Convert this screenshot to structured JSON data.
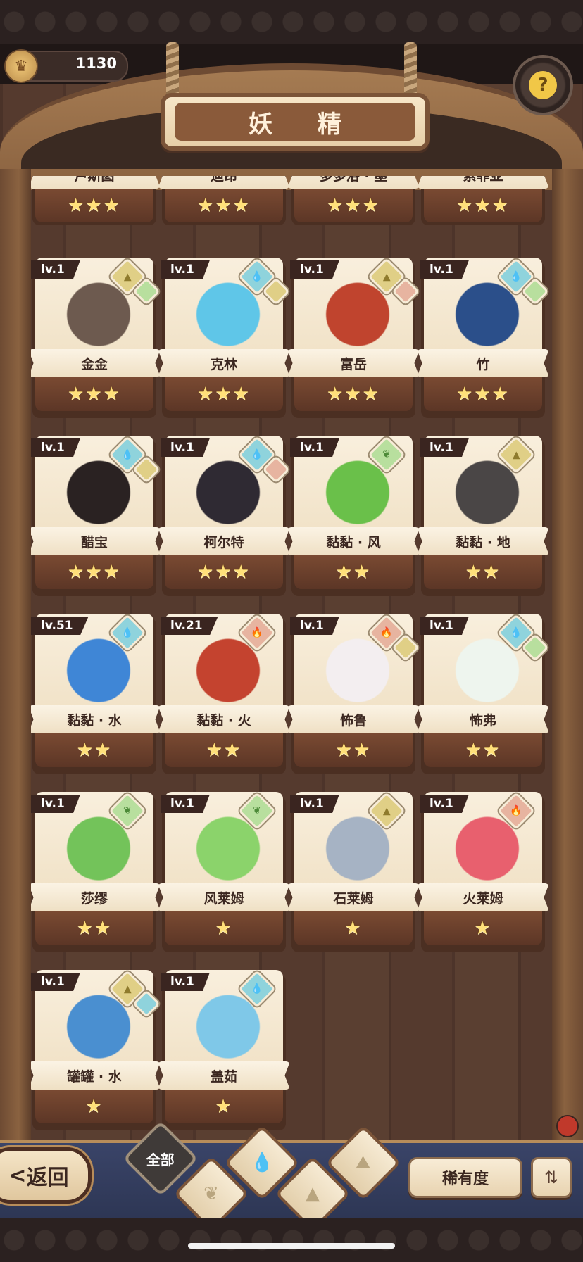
{
  "header": {
    "coins": "1130",
    "title": "妖 精",
    "coin_icon": "crown-coin-icon",
    "help_icon": "lightbulb-question-icon",
    "help_glyph": "?"
  },
  "cards_partial": [
    {
      "name": "卢斯图",
      "stars": "★★★"
    },
    {
      "name": "迪昂",
      "stars": "★★★"
    },
    {
      "name": "多多洛 · 墨",
      "stars": "★★★"
    },
    {
      "name": "索菲亚",
      "stars": "★★★"
    }
  ],
  "cards": [
    {
      "level": "lv.1",
      "name": "金金",
      "stars": "★★★",
      "elements": [
        "earth",
        "wind"
      ],
      "color": "#6d5a4f"
    },
    {
      "level": "lv.1",
      "name": "克林",
      "stars": "★★★",
      "elements": [
        "water",
        "earth"
      ],
      "color": "#5fc6e8"
    },
    {
      "level": "lv.1",
      "name": "富岳",
      "stars": "★★★",
      "elements": [
        "earth",
        "fire"
      ],
      "color": "#c0442e"
    },
    {
      "level": "lv.1",
      "name": "竹",
      "stars": "★★★",
      "elements": [
        "water",
        "wind"
      ],
      "color": "#2b4f8a"
    },
    {
      "level": "lv.1",
      "name": "醋宝",
      "stars": "★★★",
      "elements": [
        "water",
        "earth"
      ],
      "color": "#2a2222"
    },
    {
      "level": "lv.1",
      "name": "柯尔特",
      "stars": "★★★",
      "elements": [
        "water",
        "fire"
      ],
      "color": "#2f2a33"
    },
    {
      "level": "lv.1",
      "name": "黏黏 · 风",
      "stars": "★★",
      "elements": [
        "wind"
      ],
      "color": "#6ac04a"
    },
    {
      "level": "lv.1",
      "name": "黏黏 · 地",
      "stars": "★★",
      "elements": [
        "earth"
      ],
      "color": "#4a4646"
    },
    {
      "level": "lv.51",
      "name": "黏黏 · 水",
      "stars": "★★",
      "elements": [
        "water"
      ],
      "color": "#3f86d6"
    },
    {
      "level": "lv.21",
      "name": "黏黏 · 火",
      "stars": "★★",
      "elements": [
        "fire"
      ],
      "color": "#c4432f"
    },
    {
      "level": "lv.1",
      "name": "怖鲁",
      "stars": "★★",
      "elements": [
        "fire",
        "earth"
      ],
      "color": "#f3eef0"
    },
    {
      "level": "lv.1",
      "name": "怖弗",
      "stars": "★★",
      "elements": [
        "water",
        "wind"
      ],
      "color": "#eef5ee"
    },
    {
      "level": "lv.1",
      "name": "莎缪",
      "stars": "★★",
      "elements": [
        "wind"
      ],
      "color": "#73c35a"
    },
    {
      "level": "lv.1",
      "name": "风莱姆",
      "stars": "★",
      "elements": [
        "wind"
      ],
      "color": "#8bd36b"
    },
    {
      "level": "lv.1",
      "name": "石莱姆",
      "stars": "★",
      "elements": [
        "earth"
      ],
      "color": "#a6b3c4"
    },
    {
      "level": "lv.1",
      "name": "火莱姆",
      "stars": "★",
      "elements": [
        "fire"
      ],
      "color": "#e8606e"
    },
    {
      "level": "lv.1",
      "name": "罐罐 · 水",
      "stars": "★",
      "elements": [
        "earth",
        "water"
      ],
      "color": "#4a8fd0"
    },
    {
      "level": "lv.1",
      "name": "盖茹",
      "stars": "★",
      "elements": [
        "water"
      ],
      "color": "#7fc8e8"
    }
  ],
  "footer": {
    "back_label": "返回",
    "back_icon": "chevron-left-icon",
    "back_glyph": "<",
    "filter_all_label": "全部",
    "rarity_label": "稀有度",
    "sort_icon": "sort-icon",
    "sort_glyph": "⇅"
  },
  "element_glyphs": {
    "water": "💧",
    "earth": "▲",
    "wind": "❦",
    "fire": "🔥"
  }
}
